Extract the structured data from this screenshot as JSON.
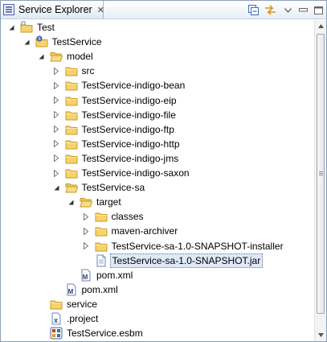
{
  "view": {
    "title": "Service Explorer",
    "close_glyph": "✕",
    "toolbar": [
      "collapse-all-icon",
      "link-with-editor-icon",
      "view-menu-icon",
      "minimize-icon",
      "maximize-icon"
    ]
  },
  "tree": [
    {
      "label": "Test",
      "icon": "project-folder-icon",
      "expanded": true,
      "depth": 0
    },
    {
      "label": "TestService",
      "icon": "service-project-icon",
      "expanded": true,
      "depth": 1
    },
    {
      "label": "model",
      "icon": "folder-open-icon",
      "expanded": true,
      "depth": 2
    },
    {
      "label": "src",
      "icon": "folder-icon",
      "expanded": false,
      "depth": 3
    },
    {
      "label": "TestService-indigo-bean",
      "icon": "folder-icon",
      "expanded": false,
      "depth": 3
    },
    {
      "label": "TestService-indigo-eip",
      "icon": "folder-icon",
      "expanded": false,
      "depth": 3
    },
    {
      "label": "TestService-indigo-file",
      "icon": "folder-icon",
      "expanded": false,
      "depth": 3
    },
    {
      "label": "TestService-indigo-ftp",
      "icon": "folder-icon",
      "expanded": false,
      "depth": 3
    },
    {
      "label": "TestService-indigo-http",
      "icon": "folder-icon",
      "expanded": false,
      "depth": 3
    },
    {
      "label": "TestService-indigo-jms",
      "icon": "folder-icon",
      "expanded": false,
      "depth": 3
    },
    {
      "label": "TestService-indigo-saxon",
      "icon": "folder-icon",
      "expanded": false,
      "depth": 3
    },
    {
      "label": "TestService-sa",
      "icon": "folder-open-icon",
      "expanded": true,
      "depth": 3
    },
    {
      "label": "target",
      "icon": "folder-open-icon",
      "expanded": true,
      "depth": 4
    },
    {
      "label": "classes",
      "icon": "folder-icon",
      "expanded": false,
      "depth": 5
    },
    {
      "label": "maven-archiver",
      "icon": "folder-icon",
      "expanded": false,
      "depth": 5
    },
    {
      "label": "TestService-sa-1.0-SNAPSHOT-installer",
      "icon": "folder-icon",
      "expanded": false,
      "depth": 5
    },
    {
      "label": "TestService-sa-1.0-SNAPSHOT.jar",
      "icon": "file-icon",
      "selected": true,
      "depth": 5
    },
    {
      "label": "pom.xml",
      "icon": "maven-pom-icon",
      "depth": 4
    },
    {
      "label": "pom.xml",
      "icon": "maven-pom-icon",
      "depth": 3
    },
    {
      "label": "service",
      "icon": "folder-icon",
      "depth": 2
    },
    {
      "label": ".project",
      "icon": "xml-file-icon",
      "depth": 2
    },
    {
      "label": "TestService.esbm",
      "icon": "esbm-file-icon",
      "depth": 2
    }
  ]
}
